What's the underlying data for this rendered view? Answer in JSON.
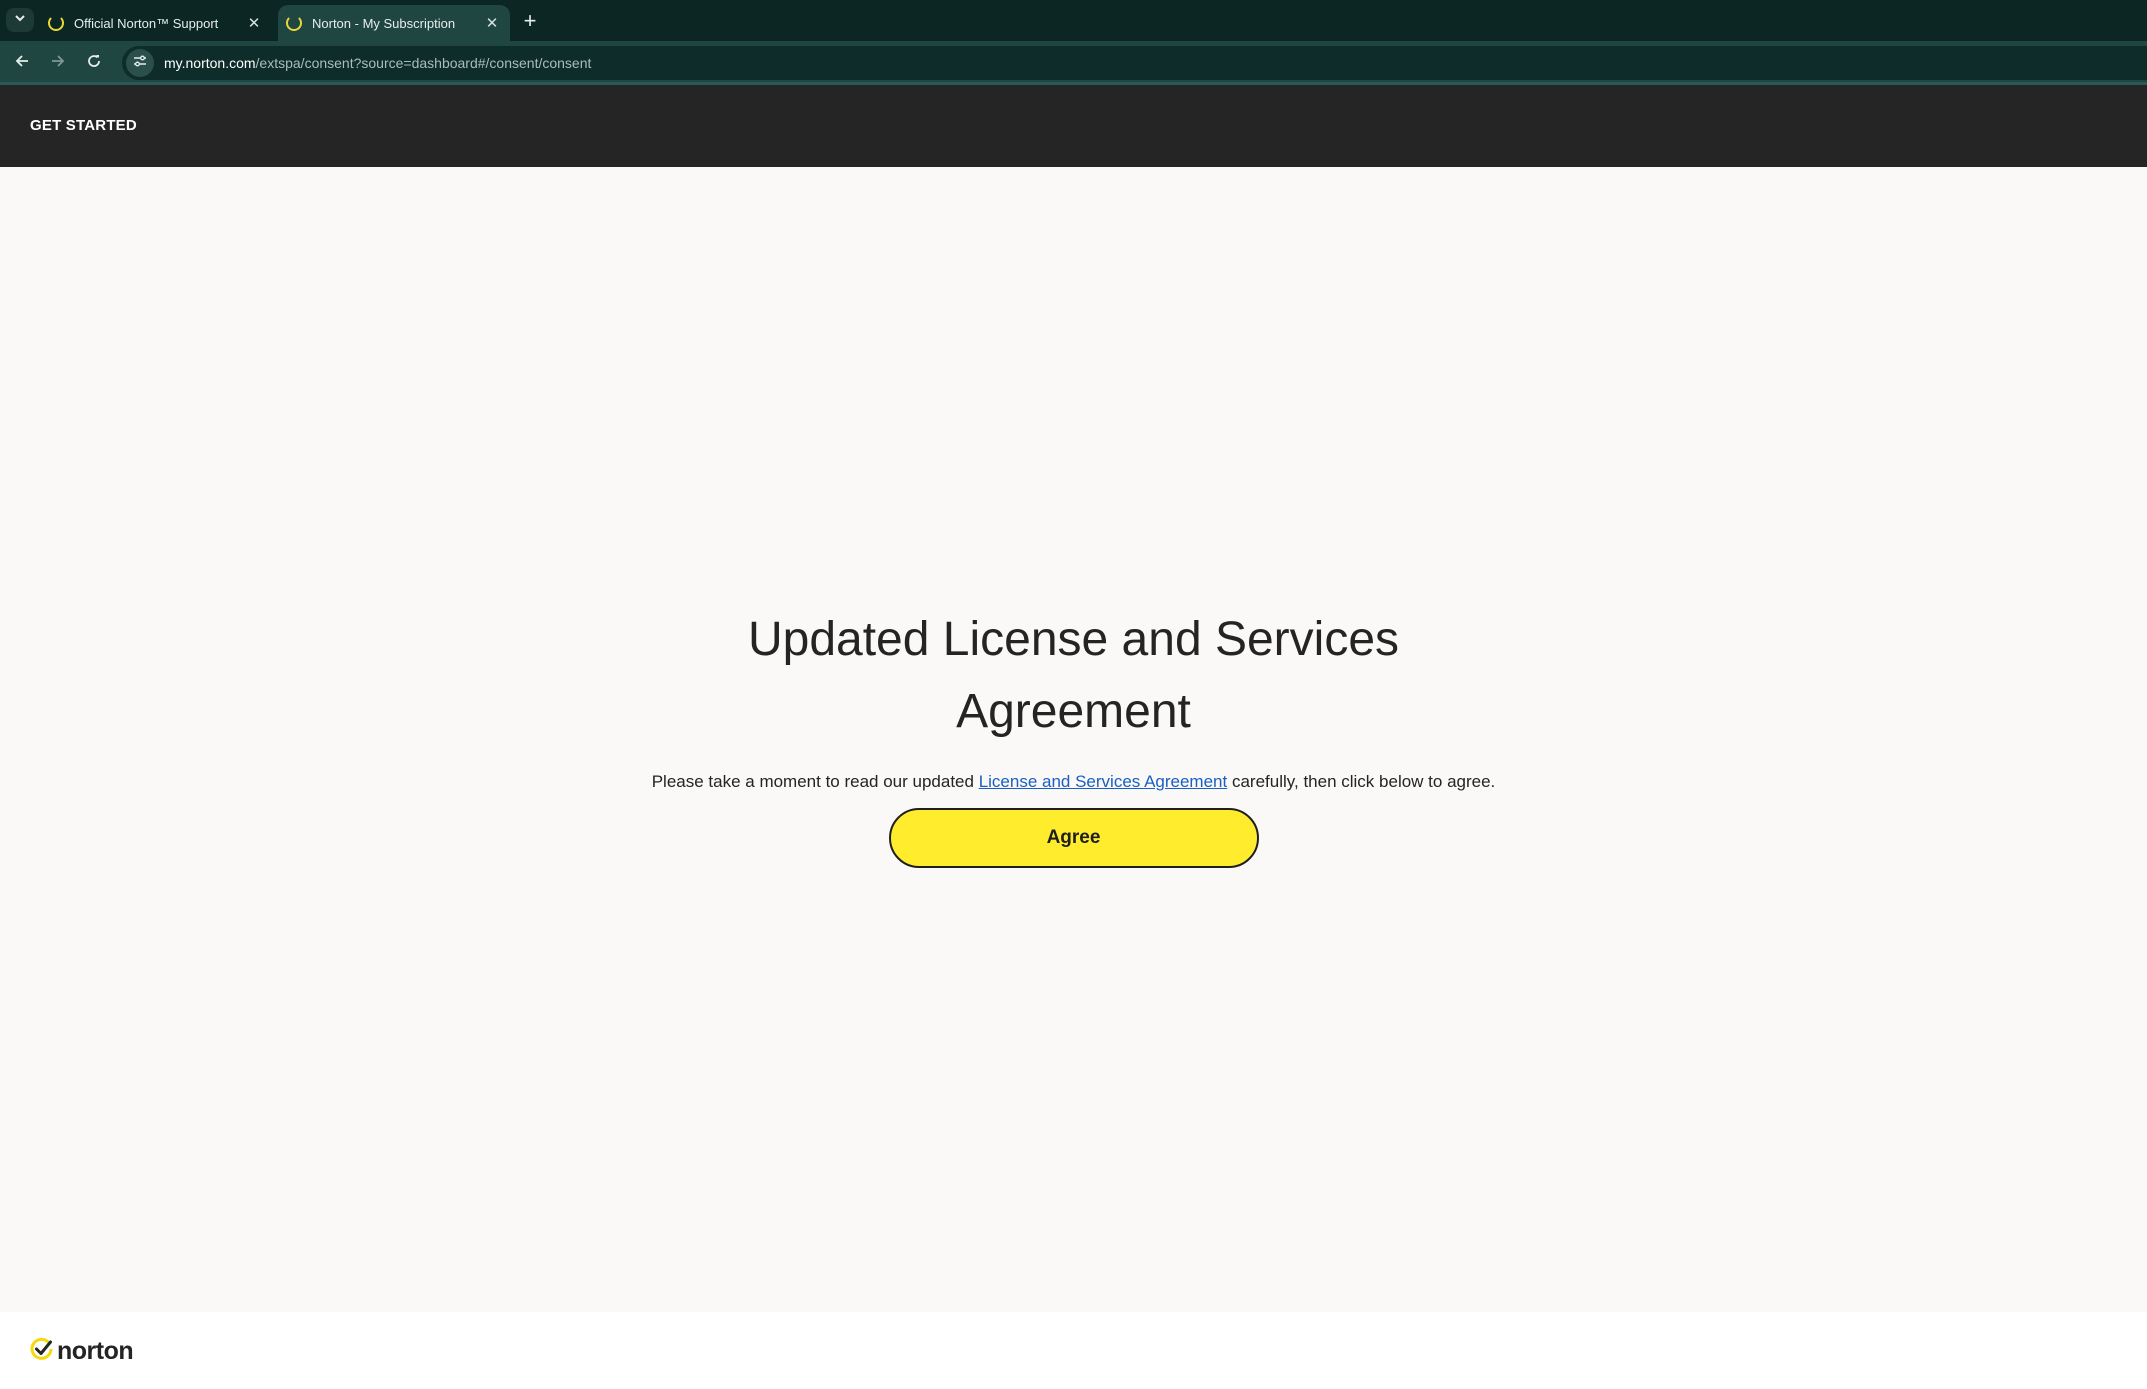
{
  "browser": {
    "tabs": [
      {
        "title": "Official Norton™ Support",
        "active": false
      },
      {
        "title": "Norton - My Subscription",
        "active": true
      }
    ],
    "url_host": "my.norton.com",
    "url_path": "/extspa/consent?source=dashboard#/consent/consent"
  },
  "header": {
    "get_started": "GET STARTED"
  },
  "main": {
    "title": "Updated License and Services Agreement",
    "lead_before": "Please take a moment to read our updated ",
    "lead_link": "License and Services Agreement",
    "lead_after": " carefully, then click below to agree.",
    "agree_label": "Agree"
  },
  "footer": {
    "logo_text": "norton"
  },
  "colors": {
    "brand_yellow": "#ffec2d",
    "header_bg": "#252525",
    "link_blue": "#1a5fc4"
  }
}
